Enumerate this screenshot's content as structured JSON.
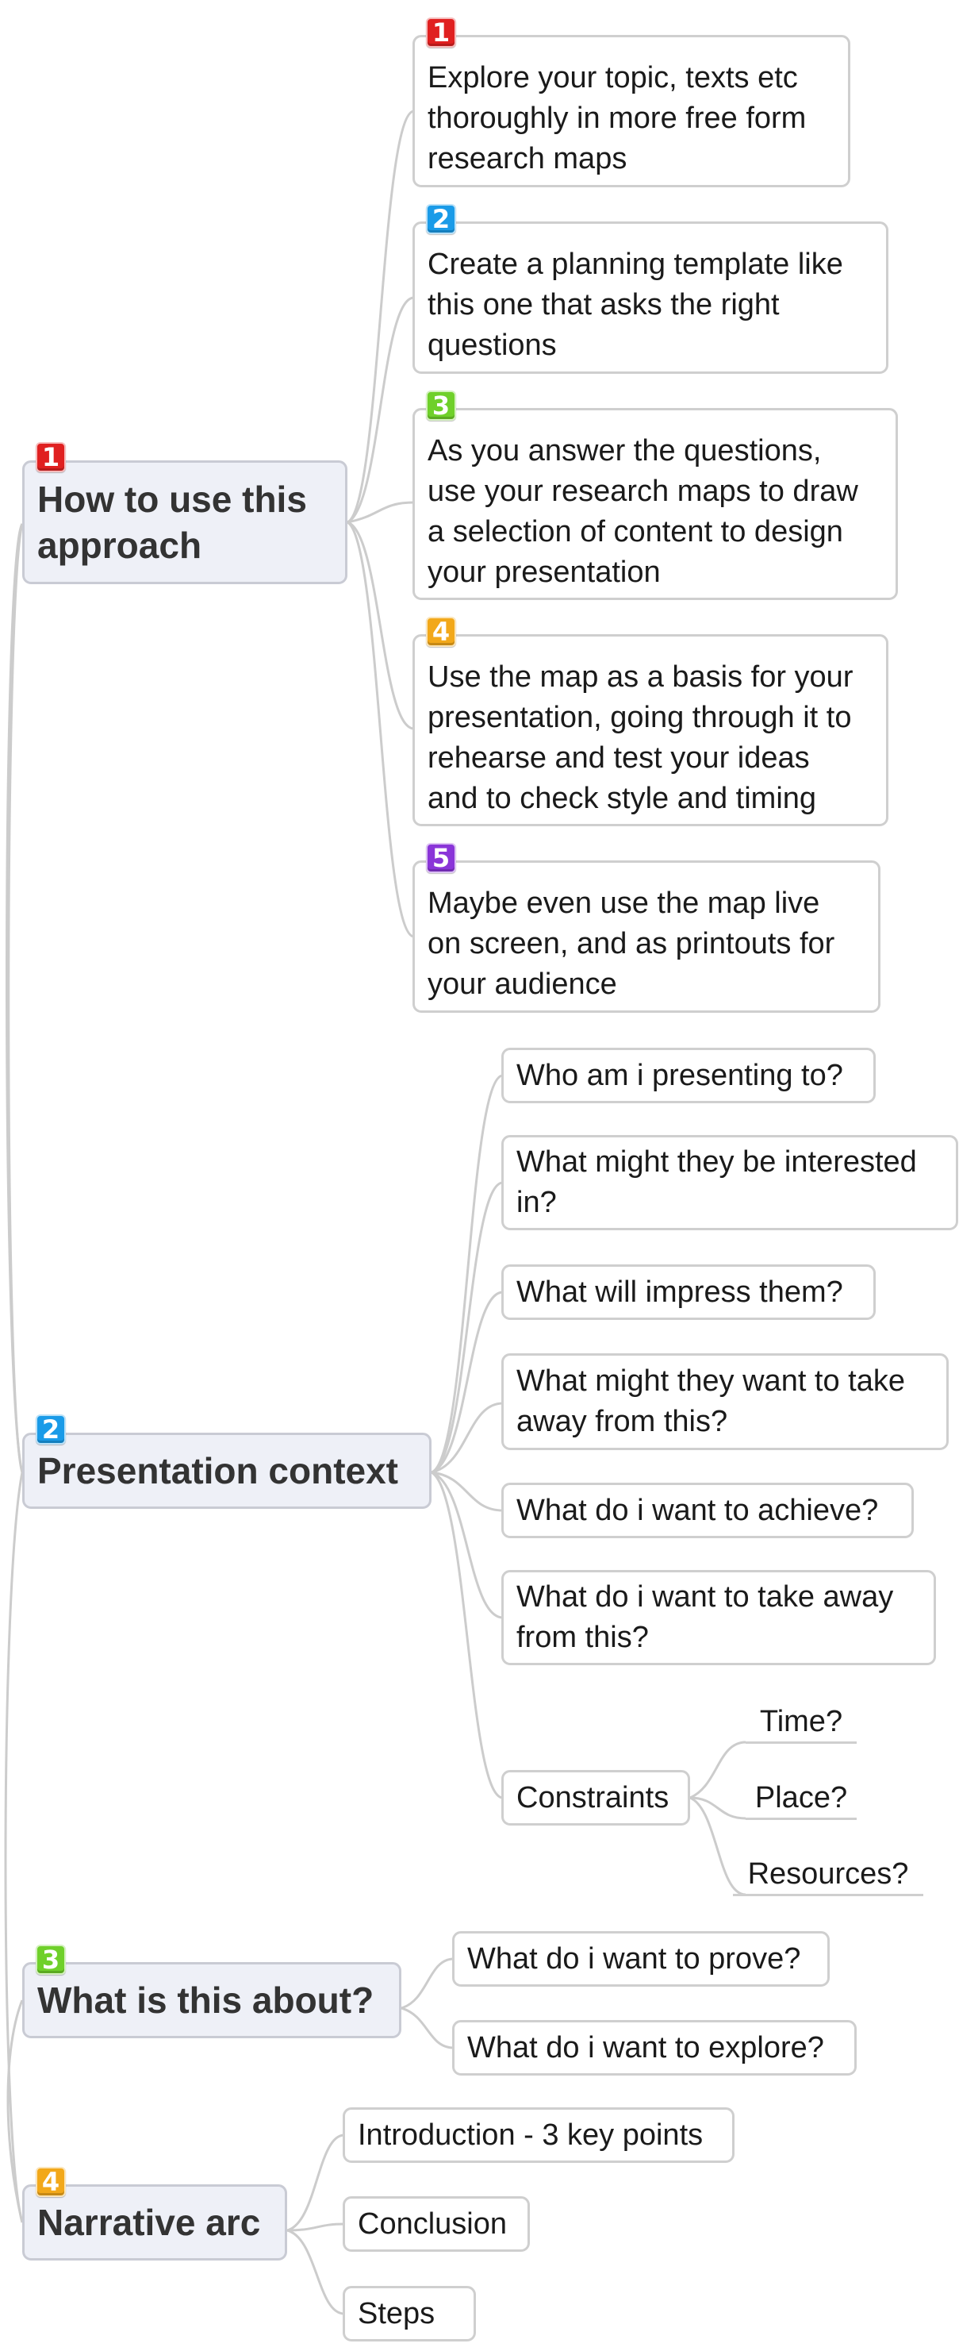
{
  "colors": {
    "red": "#e02020",
    "blue": "#1a9be8",
    "green": "#6fd02a",
    "orange": "#f2a81a",
    "purple": "#8a35d8",
    "connector": "#cccccc"
  },
  "topics": [
    {
      "badge": "1",
      "color": "#e02020",
      "title_lines": [
        "How to use this",
        "approach"
      ]
    },
    {
      "badge": "2",
      "color": "#1a9be8",
      "title_lines": [
        "Presentation context"
      ]
    },
    {
      "badge": "3",
      "color": "#6fd02a",
      "title_lines": [
        "What is this about?"
      ]
    },
    {
      "badge": "4",
      "color": "#f2a81a",
      "title_lines": [
        "Narrative arc"
      ]
    }
  ],
  "steps": [
    {
      "badge": "1",
      "color": "#e02020",
      "lines": [
        "Explore your topic, texts etc",
        "thoroughly in more free form",
        "research maps"
      ]
    },
    {
      "badge": "2",
      "color": "#1a9be8",
      "lines": [
        "Create a planning template like",
        "this one that asks the right",
        "questions"
      ]
    },
    {
      "badge": "3",
      "color": "#6fd02a",
      "lines": [
        "As you answer the questions,",
        "use your research maps to draw",
        "a selection of content to design",
        "your presentation"
      ]
    },
    {
      "badge": "4",
      "color": "#f2a81a",
      "lines": [
        "Use the map as a basis for your",
        "presentation, going through it to",
        "rehearse and test your ideas",
        "and to check style and timing"
      ]
    },
    {
      "badge": "5",
      "color": "#8a35d8",
      "lines": [
        "Maybe even use the map live",
        "on screen, and as printouts for",
        "your audience"
      ]
    }
  ],
  "context_questions": [
    {
      "lines": [
        "Who am i presenting to?"
      ]
    },
    {
      "lines": [
        "What might they be interested",
        "in?"
      ]
    },
    {
      "lines": [
        "What will impress them?"
      ]
    },
    {
      "lines": [
        "What might they want to take",
        "away from this?"
      ]
    },
    {
      "lines": [
        "What do i want to achieve?"
      ]
    },
    {
      "lines": [
        "What do i want to take away",
        "from this?"
      ]
    },
    {
      "lines": [
        "Constraints"
      ]
    }
  ],
  "constraints": [
    "Time?",
    "Place?",
    "Resources?"
  ],
  "about_questions": [
    "What do i want to prove?",
    "What do i want to explore?"
  ],
  "narrative_items": [
    "Introduction - 3 key points",
    "Conclusion",
    "Steps"
  ]
}
